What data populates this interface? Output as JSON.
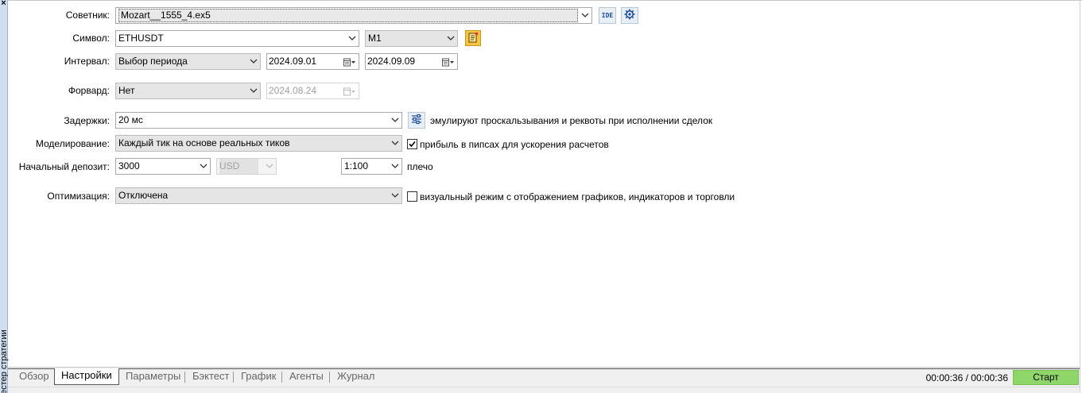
{
  "side_panel": {
    "close_glyph": "×",
    "title": "Тестер стратегии"
  },
  "advisor": {
    "label": "Советник:",
    "value": "Mozart__1555_4.ex5",
    "ide_label": "IDE"
  },
  "symbol": {
    "label": "Символ:",
    "value": "ETHUSDT",
    "timeframe": "M1"
  },
  "interval": {
    "label": "Интервал:",
    "mode": "Выбор периода",
    "date_from": "2024.09.01",
    "date_to": "2024.09.09"
  },
  "forward": {
    "label": "Форвард:",
    "mode": "Нет",
    "date": "2024.08.24"
  },
  "delays": {
    "label": "Задержки:",
    "value": "20 мс",
    "note": "эмулируют проскальзывания и реквоты при исполнении сделок"
  },
  "modeling": {
    "label": "Моделирование:",
    "value": "Каждый тик на основе реальных тиков",
    "pips_checkbox_checked": true,
    "pips_note": "прибыль в пипсах для ускорения расчетов"
  },
  "deposit": {
    "label": "Начальный депозит:",
    "amount": "3000",
    "currency": "USD",
    "leverage": "1:100",
    "leverage_label": "плечо"
  },
  "optimization": {
    "label": "Оптимизация:",
    "value": "Отключена",
    "visual_checkbox_checked": false,
    "visual_note": "визуальный режим с отображением графиков, индикаторов и торговли"
  },
  "tabs": [
    {
      "label": "Обзор",
      "active": false
    },
    {
      "label": "Настройки",
      "active": true
    },
    {
      "label": "Параметры",
      "active": false
    },
    {
      "label": "Бэктест",
      "active": false
    },
    {
      "label": "График",
      "active": false
    },
    {
      "label": "Агенты",
      "active": false
    },
    {
      "label": "Журнал",
      "active": false
    }
  ],
  "status": {
    "time": "00:00:36 / 00:00:36",
    "start_label": "Старт"
  },
  "colors": {
    "start_button": "#8fd66a",
    "side_strip": "#cfdff0",
    "icon_yellow": "#f6c343"
  }
}
